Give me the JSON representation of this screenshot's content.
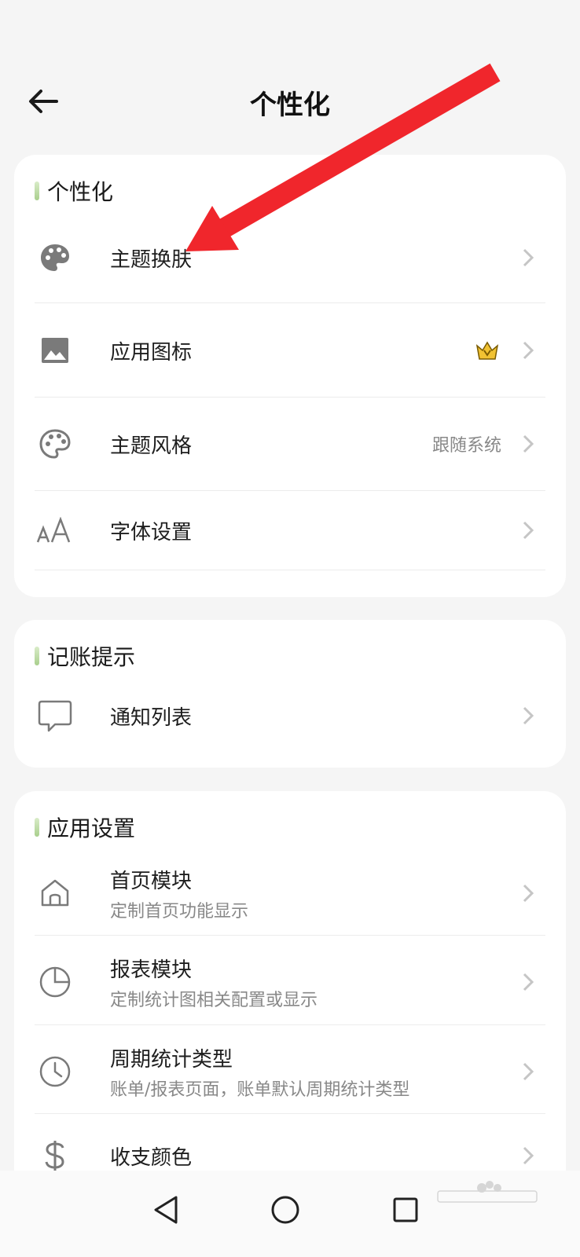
{
  "header": {
    "title": "个性化"
  },
  "sections": {
    "personal": {
      "title": "个性化",
      "items": [
        {
          "label": "主题换肤",
          "icon": "palette-icon"
        },
        {
          "label": "应用图标",
          "icon": "image-icon",
          "badge": "crown-vip-icon"
        },
        {
          "label": "主题风格",
          "value": "跟随系统",
          "icon": "palette-outline-icon"
        },
        {
          "label": "字体设置",
          "icon": "font-size-icon"
        }
      ]
    },
    "reminder": {
      "title": "记账提示",
      "items": [
        {
          "label": "通知列表",
          "icon": "message-icon"
        }
      ]
    },
    "app": {
      "title": "应用设置",
      "items": [
        {
          "label": "首页模块",
          "sub": "定制首页功能显示",
          "icon": "home-icon"
        },
        {
          "label": "报表模块",
          "sub": "定制统计图相关配置或显示",
          "icon": "pie-chart-icon"
        },
        {
          "label": "周期统计类型",
          "sub": "账单/报表页面，账单默认周期统计类型",
          "icon": "clock-icon"
        },
        {
          "label": "收支颜色",
          "icon": "dollar-icon"
        }
      ]
    }
  },
  "colors": {
    "accent_arrow": "#f0262c",
    "section_bar": "#a9cf8d",
    "crown": "#f1c232"
  }
}
